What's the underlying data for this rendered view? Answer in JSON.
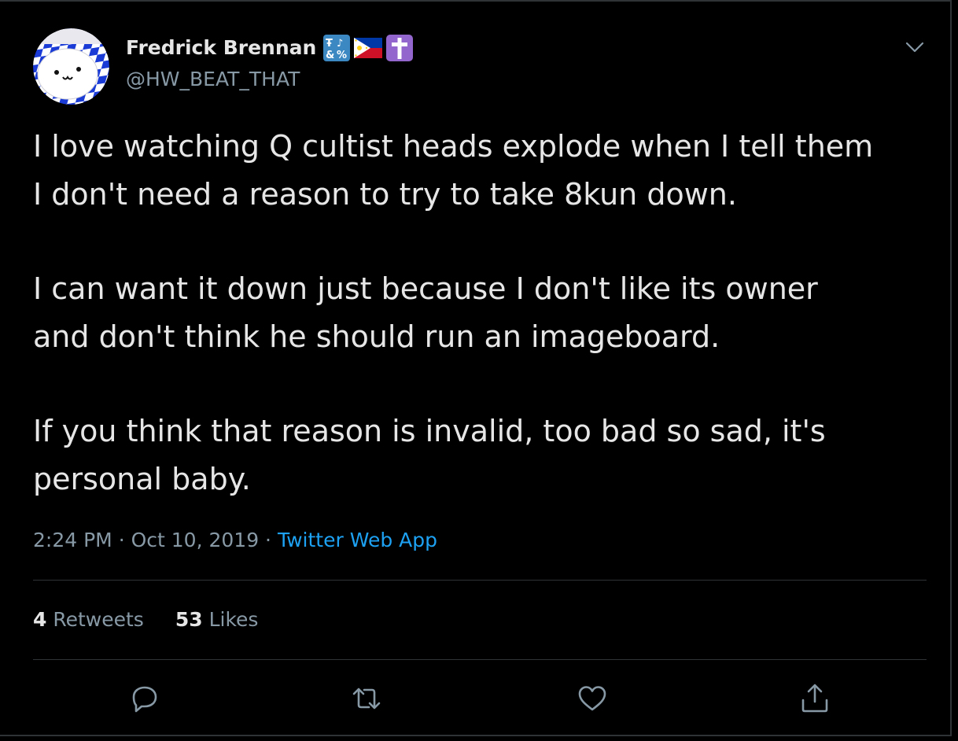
{
  "author": {
    "display_name": "Fredrick Brennan",
    "handle": "@HW_BEAT_THAT",
    "badges": [
      "symbols-icon",
      "philippines-flag-icon",
      "latin-cross-icon"
    ]
  },
  "tweet": {
    "paragraphs": [
      [
        "I love watching Q cultist heads explode when I tell them",
        "I don't need a reason to try to take 8kun down."
      ],
      [
        "I can want it down just because I don't like its owner",
        "and don't think he should run an imageboard."
      ],
      [
        "If you think that reason is invalid, too bad so sad, it's",
        "personal baby."
      ]
    ],
    "time": "2:24 PM",
    "date": "Oct 10, 2019",
    "separator": "·",
    "source": "Twitter Web App"
  },
  "stats": {
    "retweets_count": "4",
    "retweets_label": "Retweets",
    "likes_count": "53",
    "likes_label": "Likes"
  },
  "actions": [
    "reply-icon",
    "retweet-icon",
    "like-icon",
    "share-icon"
  ],
  "colors": {
    "background": "#000000",
    "text": "#e6e6e6",
    "muted": "#8899a6",
    "link": "#1da1f2",
    "divider": "#2f3336"
  }
}
